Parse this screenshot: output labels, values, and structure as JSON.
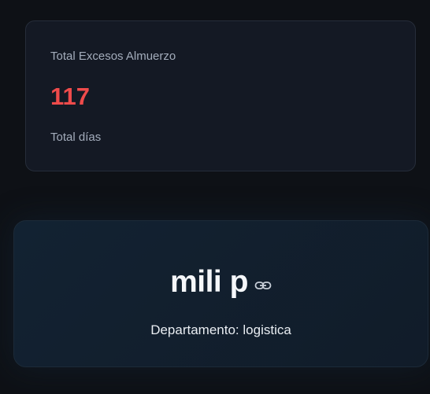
{
  "metric": {
    "label": "Total Excesos Almuerzo",
    "value": "117",
    "sublabel": "Total días",
    "value_color": "#ef4b4b"
  },
  "profile": {
    "name": "mili p",
    "department": "Departamento: logistica",
    "link_icon": "link-icon"
  }
}
